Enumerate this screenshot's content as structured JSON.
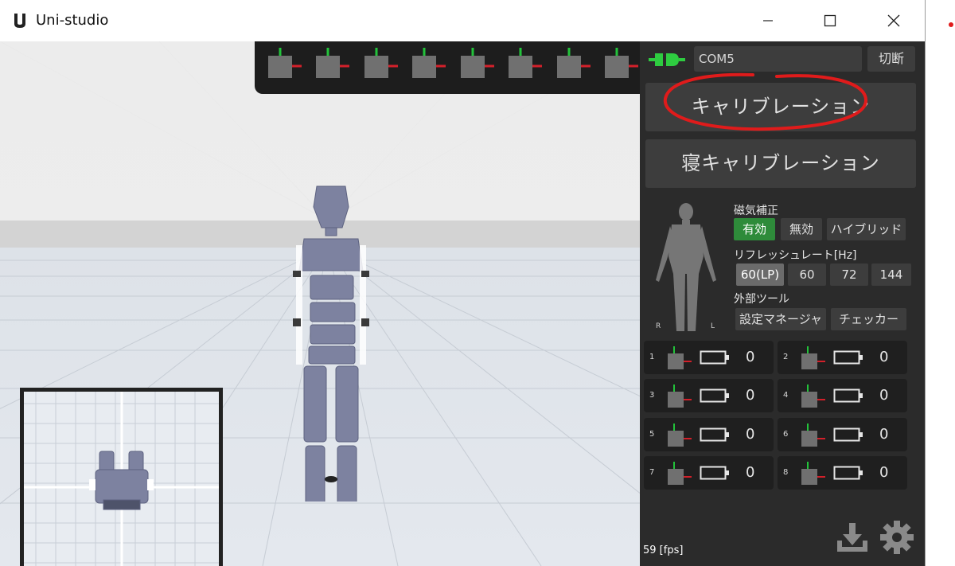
{
  "window": {
    "title": "Uni-studio",
    "controls": [
      "minimize",
      "maximize",
      "close"
    ]
  },
  "connection": {
    "port_value": "COM5",
    "disconnect_label": "切断"
  },
  "actions": {
    "calibration_label": "キャリブレーション",
    "sleep_calibration_label": "寝キャリブレーション"
  },
  "magnetic": {
    "label": "磁気補正",
    "options": [
      "有効",
      "無効",
      "ハイブリッド"
    ],
    "selected": "有効"
  },
  "refresh": {
    "label": "リフレッシュレート[Hz]",
    "options": [
      "60(LP)",
      "60",
      "72",
      "144"
    ],
    "selected": "60(LP)"
  },
  "external_tools": {
    "label": "外部ツール",
    "items": [
      "設定マネージャ",
      "チェッカー"
    ]
  },
  "body_side_labels": {
    "right": "R",
    "left": "L"
  },
  "trackers": [
    {
      "index": "1",
      "value": "0"
    },
    {
      "index": "2",
      "value": "0"
    },
    {
      "index": "3",
      "value": "0"
    },
    {
      "index": "4",
      "value": "0"
    },
    {
      "index": "5",
      "value": "0"
    },
    {
      "index": "6",
      "value": "0"
    },
    {
      "index": "7",
      "value": "0"
    },
    {
      "index": "8",
      "value": "0"
    }
  ],
  "status": {
    "fps": "59 [fps]"
  },
  "colors": {
    "panel_bg": "#2b2b2b",
    "button_bg": "#3d3d3d",
    "active_green": "#2e8b3a",
    "annotation_red": "#e01b1b",
    "axis_green": "#22c33a",
    "axis_red": "#d3202a"
  },
  "icons": {
    "app": "app-logo-icon",
    "connection": "plug-icon",
    "download": "download-icon",
    "settings": "gear-icon"
  }
}
